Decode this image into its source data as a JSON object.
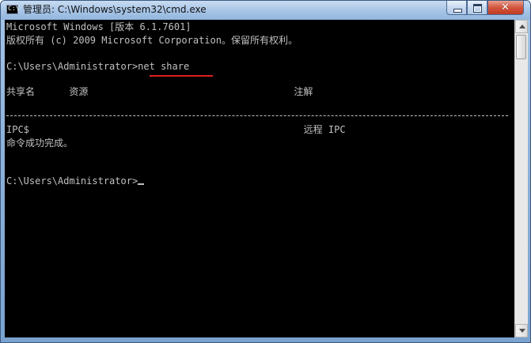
{
  "window": {
    "title": "管理员: C:\\Windows\\system32\\cmd.exe",
    "icon": "cmd-icon",
    "icon_label": "C:\\",
    "controls": {
      "minimize": "minimize-icon",
      "maximize": "maximize-icon",
      "close_label": "✕"
    }
  },
  "console": {
    "lines": [
      "Microsoft Windows [版本 6.1.7601]",
      "版权所有 (c) 2009 Microsoft Corporation。保留所有权利。",
      "C:\\Users\\Administrator>net share",
      "共享名      资源                                    注解",
      "IPC$                                                远程 IPC",
      "命令成功完成。",
      "C:\\Users\\Administrator>"
    ],
    "highlighted_command": "net share",
    "highlight_color": "#e02020",
    "text_color": "#c0c0c0",
    "background_color": "#000000"
  },
  "scrollbar": {
    "up_icon": "scroll-up-arrow-icon",
    "down_icon": "scroll-down-arrow-icon"
  }
}
